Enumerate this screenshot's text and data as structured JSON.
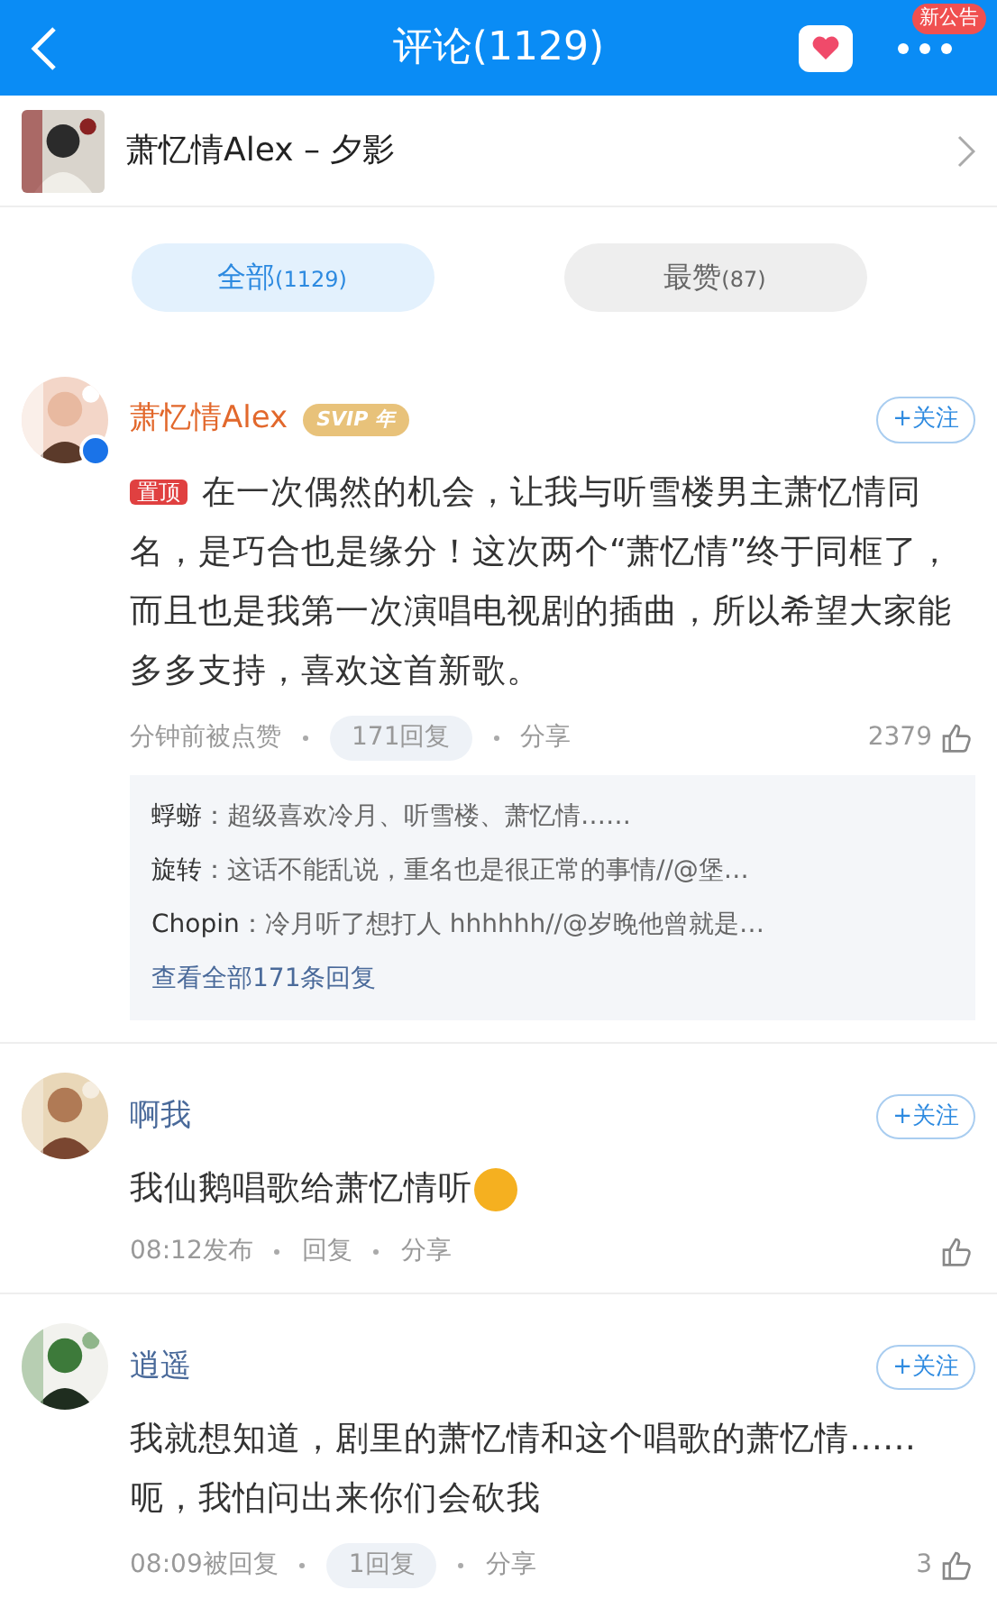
{
  "header": {
    "title": "评论(1129)",
    "badge": "新公告"
  },
  "song": {
    "title": "萧忆情Alex – 夕影"
  },
  "tabs": [
    {
      "label": "全部",
      "count": "(1129)",
      "selected": true
    },
    {
      "label": "最赞",
      "count": "(87)",
      "selected": false
    }
  ],
  "comments": [
    {
      "user": "萧忆情Alex",
      "vip": "SVIP 年",
      "verified": true,
      "follow": "+关注",
      "pinned": "置顶",
      "text": "在一次偶然的机会，让我与听雪楼男主萧忆情同名，是巧合也是缘分！这次两个“萧忆情”终于同框了，而且也是我第一次演唱电视剧的插曲，所以希望大家能多多支持，喜欢这首新歌。",
      "time": "分钟前被点赞",
      "reply": "171回复",
      "reply_highlight": true,
      "share": "分享",
      "likes": "2379",
      "replies": [
        {
          "name": "蜉蝣",
          "text": "：超级喜欢冷月、听雪楼、萧忆情……"
        },
        {
          "name": "旋转",
          "text": "：这话不能乱说，重名也是很正常的事情//@堡…"
        },
        {
          "name": "Chopin",
          "text": "：冷月听了想打人 hhhhhh//@岁晚他曾就是…"
        }
      ],
      "more": "查看全部171条回复"
    },
    {
      "user": "啊我",
      "verified": false,
      "follow": "+关注",
      "text": "我仙鹅唱歌给萧忆情听",
      "emoji": true,
      "time": "08:12发布",
      "reply": "回复",
      "reply_highlight": false,
      "share": "分享"
    },
    {
      "user": "逍遥",
      "verified": false,
      "follow": "+关注",
      "text": "我就想知道，剧里的萧忆情和这个唱歌的萧忆情……呃，我怕问出来你们会砍我",
      "time": "08:09被回复",
      "reply": "1回复",
      "reply_highlight": true,
      "share": "分享",
      "likes": "3"
    }
  ]
}
